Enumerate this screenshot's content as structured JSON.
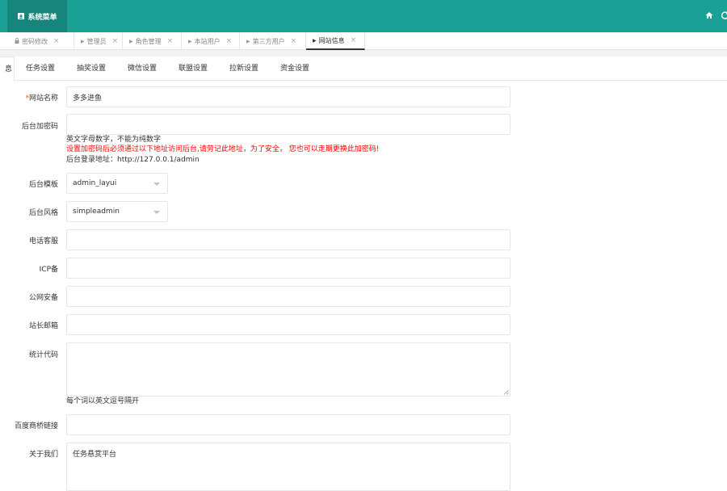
{
  "header": {
    "brand_label": "系统菜单",
    "brand_icon": "menu-icon",
    "home_icon": "home-icon",
    "refresh_icon": "refresh-icon",
    "bg_color": "#1aa094",
    "brand_bg_color": "#17857b"
  },
  "tabs": [
    {
      "label": "密码修改",
      "lead_icon": "lock-icon"
    },
    {
      "label": "管理员",
      "lead_icon": "caret-right-icon"
    },
    {
      "label": "角色管理",
      "lead_icon": "caret-right-icon"
    },
    {
      "label": "本站用户",
      "lead_icon": "caret-right-icon"
    },
    {
      "label": "第三方用户",
      "lead_icon": "caret-right-icon"
    },
    {
      "label": "网站信息",
      "lead_icon": "caret-right-icon",
      "active": true
    }
  ],
  "subtabs": [
    {
      "label": "息",
      "active": true
    },
    {
      "label": "任务设置"
    },
    {
      "label": "抽奖设置"
    },
    {
      "label": "微信设置"
    },
    {
      "label": "联盟设置"
    },
    {
      "label": "拉新设置"
    },
    {
      "label": "资金设置"
    }
  ],
  "form": {
    "site_name": {
      "required_mark": "*",
      "label": "网站名称",
      "value": "多多进鱼"
    },
    "admin_key": {
      "label": "后台加密码",
      "value": "",
      "help1": "英文字母数字，不能为纯数字",
      "help2": "设置加密码后必须通过以下地址访问后台,请劳记此地址，为了安全， 您也可以走期更换此加密码!",
      "help3": "后台登录地址：http://127.0.0.1/admin"
    },
    "admin_template": {
      "label": "后台模板",
      "value": "admin_layui"
    },
    "admin_style": {
      "label": "后台风格",
      "value": "simpleadmin"
    },
    "phone": {
      "label": "电话客服",
      "value": ""
    },
    "icp": {
      "label": "ICP备",
      "value": ""
    },
    "police": {
      "label": "公网安备",
      "value": ""
    },
    "email": {
      "label": "站长邮箱",
      "value": ""
    },
    "stats_code": {
      "label": "统计代码",
      "value": "",
      "help": "每个词以英文逗号隔开"
    },
    "baidu_link": {
      "label": "百度商桥链接",
      "value": ""
    },
    "about": {
      "label": "关于我们",
      "value": "任务悬赏平台"
    }
  },
  "colors": {
    "help_red": "#ff0000",
    "required": "#ff5722"
  }
}
